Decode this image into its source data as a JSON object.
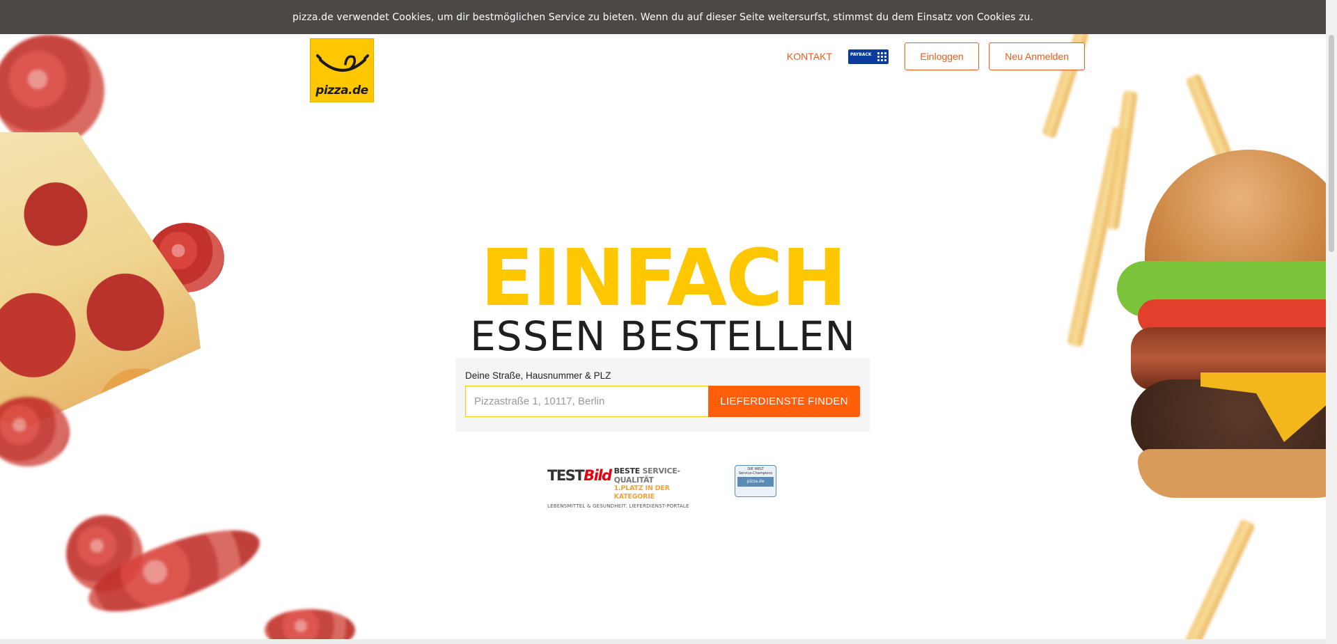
{
  "cookie_banner": {
    "text": "pizza.de verwendet Cookies, um dir bestmöglichen Service zu bieten. Wenn du auf dieser Seite weitersurfst, stimmst du dem Einsatz von Cookies zu."
  },
  "header": {
    "logo_text": "pizza.de",
    "nav": {
      "contact_label": "KONTAKT",
      "payback_label": "PAYBACK",
      "login_label": "Einloggen",
      "register_label": "Neu Anmelden"
    }
  },
  "hero": {
    "title": "EINFACH",
    "subtitle": "ESSEN BESTELLEN"
  },
  "search": {
    "label": "Deine Straße, Hausnummer & PLZ",
    "placeholder": "Pizzastraße 1, 10117, Berlin",
    "value": "",
    "button_label": "LIEFERDIENSTE FINDEN"
  },
  "badges": {
    "testbild": {
      "brand_test": "TEST",
      "brand_bild": "Bild",
      "line1_strong": "BESTE",
      "line1_rest": "SERVICE-QUALITÄT",
      "line2": "1.PLATZ IN DER KATEGORIE",
      "line3": "LEBENSMITTEL & GESUNDHEIT: LIEFERDIENST-PORTALE"
    },
    "welt": {
      "line1": "DIE WELT",
      "line2": "Service-Champions",
      "line3": "pizza.de"
    }
  },
  "colors": {
    "brand_yellow": "#ffc700",
    "accent_orange": "#ff5f0b",
    "cookie_bg": "#4b4845"
  }
}
